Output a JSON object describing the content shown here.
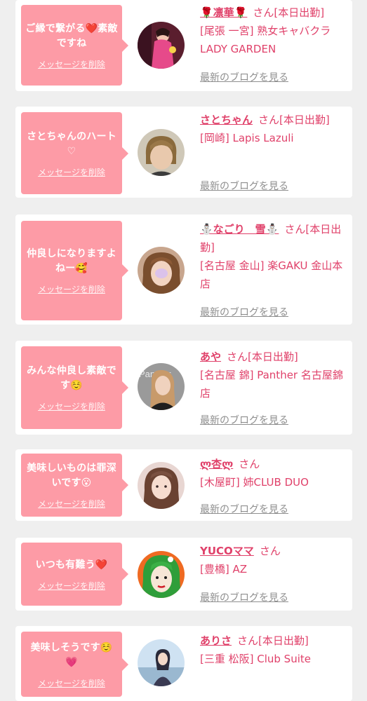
{
  "delete_label": "メッセージを削除",
  "blog_label": "最新のブログを見る",
  "colors": {
    "background": "#efefef",
    "card": "#ffffff",
    "bubble": "#fd9ba6",
    "accent": "#e0416a",
    "link_gray": "#8f8f8f"
  },
  "items": [
    {
      "message": "ご縁で繋がる❤️素敵ですね",
      "name": "🌹凛華🌹",
      "suffix": "さん[本日出勤]",
      "shop": "[尾張 一宮] 熟女キャバクラ LADY GARDEN",
      "avatar_icon": "avatar-rinka"
    },
    {
      "message": "さとちゃんのハート♡",
      "name": "さとちゃん",
      "suffix": "さん[本日出勤]",
      "shop": "[岡崎] Lapis Lazuli",
      "avatar_icon": "avatar-satochan"
    },
    {
      "message": "仲良しになりますよねー🥰",
      "name": "⛄なごり　雪⛄",
      "suffix": "さん[本日出勤]",
      "shop": "[名古屋 金山] 楽GAKU 金山本店",
      "avatar_icon": "avatar-nagori"
    },
    {
      "message": "みんな仲良し素敵です☺️",
      "name": "あや",
      "suffix": "さん[本日出勤]",
      "shop": "[名古屋 錦] Panther 名古屋錦店",
      "avatar_icon": "avatar-aya"
    },
    {
      "message": "美味しいものは罪深いです😮",
      "name": "ლ杏ლ",
      "suffix": "さん",
      "shop": "[木屋町] 姉CLUB DUO",
      "avatar_icon": "avatar-an"
    },
    {
      "message": "いつも有難う❤️",
      "name": "YUCOママ",
      "suffix": "さん",
      "shop": "[豊橋] AZ",
      "avatar_icon": "avatar-yuco"
    },
    {
      "message": "美味しそうです☺️💗",
      "name": "ありさ",
      "suffix": "さん[本日出勤]",
      "shop": "[三重 松阪] Club Suite",
      "avatar_icon": "avatar-arisa"
    }
  ]
}
